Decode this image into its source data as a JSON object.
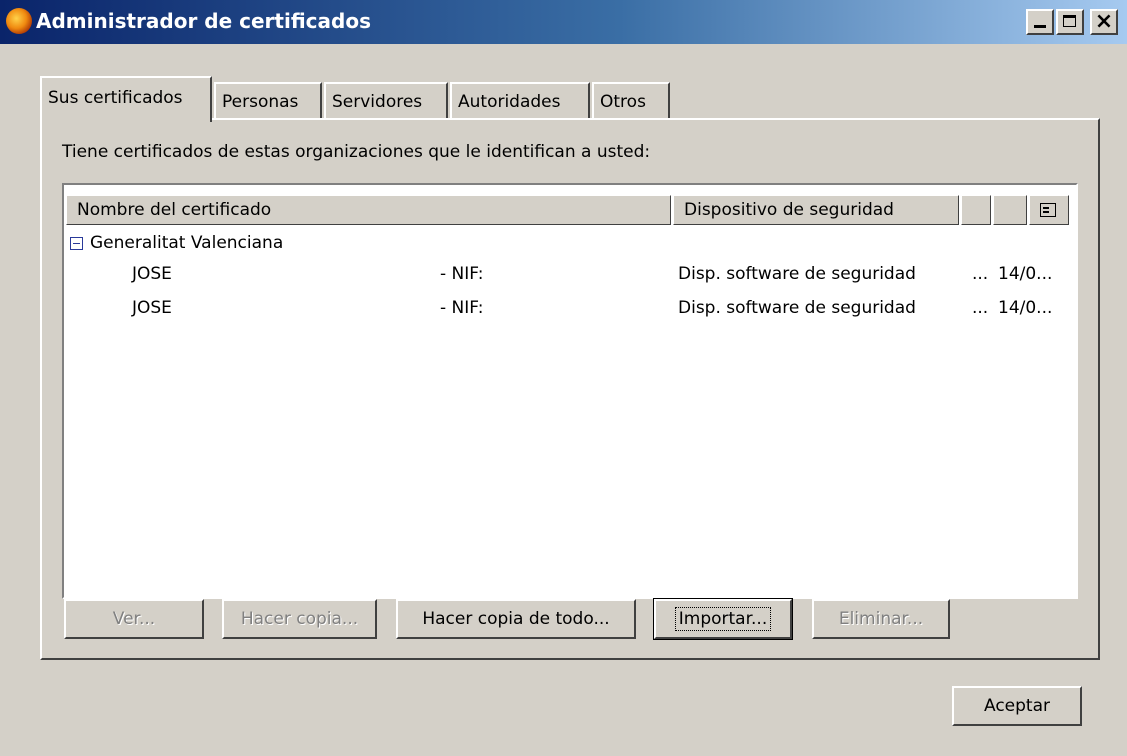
{
  "window": {
    "title": "Administrador de certificados",
    "buttons": {
      "close": "×"
    }
  },
  "tabs": [
    {
      "label": "Sus certificados",
      "active": true
    },
    {
      "label": "Personas"
    },
    {
      "label": "Servidores"
    },
    {
      "label": "Autoridades"
    },
    {
      "label": "Otros"
    }
  ],
  "intro_text": "Tiene certificados de estas organizaciones que le identifican a usted:",
  "table": {
    "columns": [
      "Nombre del certificado",
      "Dispositivo de seguridad",
      "",
      ""
    ],
    "column_picker_icon": "column-picker-icon",
    "group": {
      "label": "Generalitat Valenciana",
      "expanded": true
    },
    "rows": [
      {
        "name": "JOSE",
        "nif": "- NIF:",
        "device": "Disp. software de seguridad",
        "col3": "...",
        "col4": "14/0..."
      },
      {
        "name": "JOSE",
        "nif": "- NIF:",
        "device": "Disp. software de seguridad",
        "col3": "...",
        "col4": "14/0..."
      }
    ]
  },
  "buttons": {
    "view": "Ver...",
    "backup": "Hacer copia...",
    "backup_all": "Hacer copia de todo...",
    "import": "Importar...",
    "delete": "Eliminar...",
    "ok": "Aceptar"
  },
  "colors": {
    "title_bar_start": "#0a246a",
    "title_bar_end": "#a6caf0",
    "dialog_bg": "#d4d0c8"
  }
}
